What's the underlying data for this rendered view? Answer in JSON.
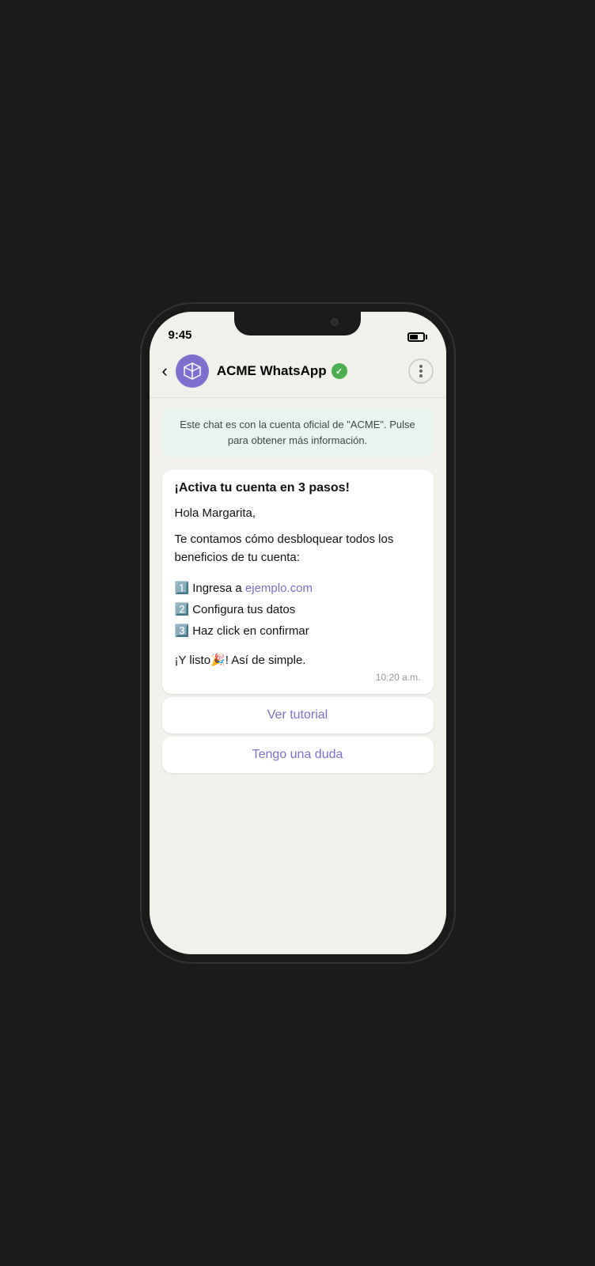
{
  "status": {
    "time": "9:45"
  },
  "header": {
    "app_name": "ACME WhatsApp",
    "back_label": "<",
    "verified": true
  },
  "official_notice": {
    "text": "Este chat es con la cuenta oficial de \"ACME\". Pulse para obtener más información."
  },
  "message": {
    "title": "¡Activa tu cuenta en 3 pasos!",
    "greeting": "Hola Margarita,",
    "body": "Te contamos cómo desbloquear todos los beneficios de tu cuenta:",
    "steps": [
      {
        "number": "1️⃣",
        "text": "Ingresa a ",
        "link": "ejemplo.com",
        "link_after": ""
      },
      {
        "number": "2️⃣",
        "text": "Configura tus datos",
        "link": null
      },
      {
        "number": "3️⃣",
        "text": "Haz click en confirmar",
        "link": null
      }
    ],
    "ending": "¡Y listo🎉! Así de simple.",
    "time": "10:20 a.m."
  },
  "buttons": [
    {
      "label": "Ver tutorial"
    },
    {
      "label": "Tengo una duda"
    }
  ]
}
